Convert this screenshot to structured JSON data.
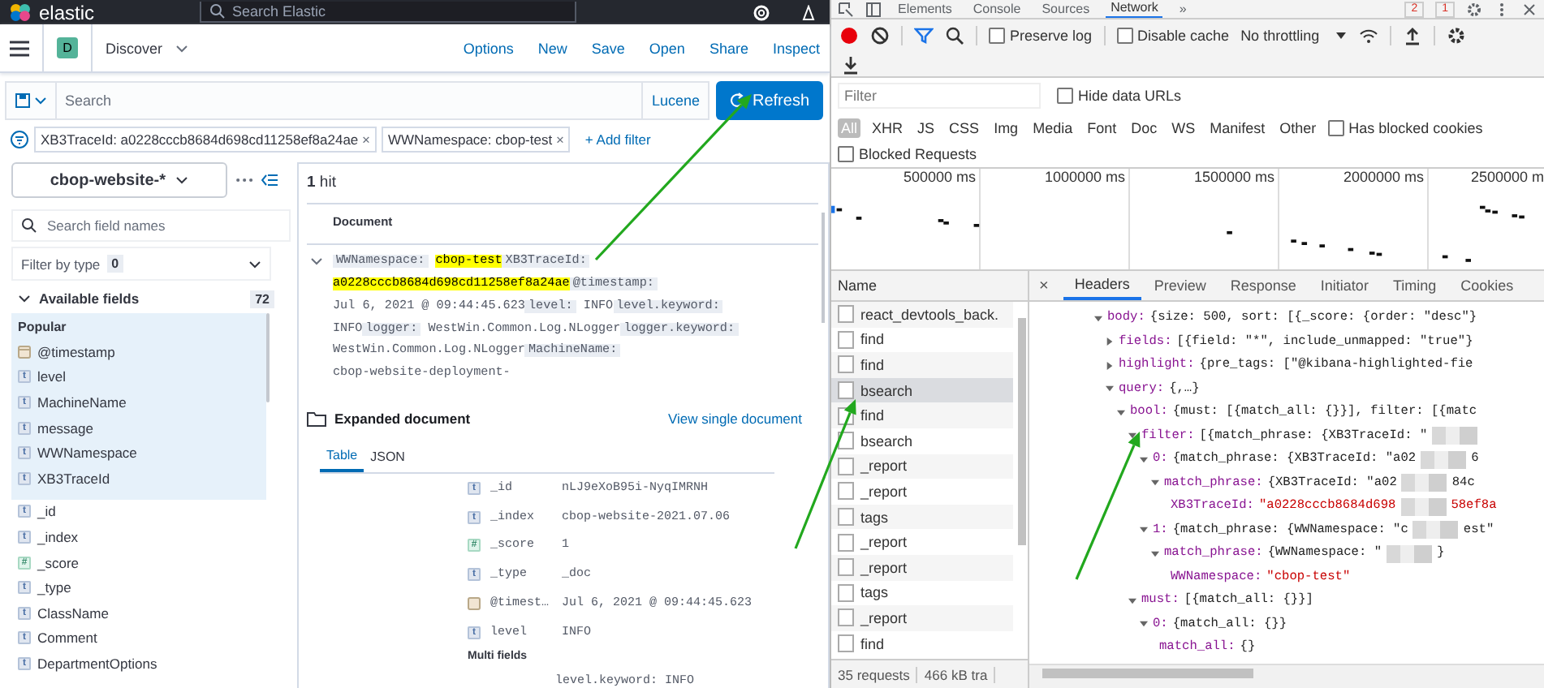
{
  "kibana": {
    "header": {
      "logo_text": "elastic",
      "search_placeholder": "Search Elastic"
    },
    "nav": {
      "app_badge": "D",
      "app_name": "Discover",
      "links": [
        "Options",
        "New",
        "Save",
        "Open",
        "Share",
        "Inspect"
      ]
    },
    "query_bar": {
      "placeholder": "Search",
      "language": "Lucene",
      "refresh": "Refresh"
    },
    "filters": [
      {
        "label": "XB3TraceId: a0228cccb8684d698cd11258ef8a24ae",
        "remove": "×"
      },
      {
        "label": "WWNamespace: cbop-test",
        "remove": "×"
      }
    ],
    "add_filter": "+ Add filter",
    "sidebar": {
      "index_pattern": "cbop-website-*",
      "search_placeholder": "Search field names",
      "filter_by_type": {
        "label": "Filter by type",
        "count": "0"
      },
      "available": {
        "label": "Available fields",
        "count": "72"
      },
      "popular_label": "Popular",
      "popular": [
        {
          "kind": "date",
          "name": "@timestamp"
        },
        {
          "kind": "string",
          "token": "t",
          "name": "level"
        },
        {
          "kind": "string",
          "token": "t",
          "name": "MachineName"
        },
        {
          "kind": "string",
          "token": "t",
          "name": "message"
        },
        {
          "kind": "string",
          "token": "t",
          "name": "WWNamespace"
        },
        {
          "kind": "string",
          "token": "t",
          "name": "XB3TraceId"
        }
      ],
      "fields": [
        {
          "kind": "string",
          "token": "t",
          "name": "_id"
        },
        {
          "kind": "string",
          "token": "t",
          "name": "_index"
        },
        {
          "kind": "number",
          "token": "#",
          "name": "_score"
        },
        {
          "kind": "string",
          "token": "t",
          "name": "_type"
        },
        {
          "kind": "string",
          "token": "t",
          "name": "ClassName"
        },
        {
          "kind": "string",
          "token": "t",
          "name": "Comment"
        },
        {
          "kind": "string",
          "token": "t",
          "name": "DepartmentOptions"
        }
      ]
    },
    "results": {
      "hits": "**1** hit",
      "document_header": "Document",
      "summary": [
        {
          "key": "WWNamespace:",
          "value": "cbop-test",
          "highlighted": true
        },
        {
          "key": "XB3TraceId:",
          "value": "a0228cccb8684d698cd11258ef8a24ae",
          "highlighted": true
        },
        {
          "key": "@timestamp:",
          "value": "Jul 6, 2021 @ 09:44:45.623",
          "highlighted": false
        },
        {
          "key": "level:",
          "value": "INFO",
          "highlighted": false
        },
        {
          "key": "level.keyword:",
          "value": "INFO",
          "highlighted": false
        },
        {
          "key": "logger:",
          "value": "WestWin.Common.Log.NLogger",
          "highlighted": false
        },
        {
          "key": "logger.keyword:",
          "value": "WestWin.Common.Log.NLogger",
          "highlighted": false
        },
        {
          "key": "MachineName:",
          "value": "cbop-website-deployment-",
          "highlighted": false
        }
      ],
      "expanded_title": "Expanded document",
      "view_single": "View single document",
      "tabs": [
        {
          "label": "Table",
          "selected": true
        },
        {
          "label": "JSON",
          "selected": false
        }
      ],
      "rows": [
        {
          "kind": "string",
          "token": "t",
          "field": "_id",
          "value": "nLJ9eXoB95i-NyqIMRNH"
        },
        {
          "kind": "string",
          "token": "t",
          "field": "_index",
          "value": "cbop-website-2021.07.06"
        },
        {
          "kind": "number",
          "token": "#",
          "field": "_score",
          "value": "1"
        },
        {
          "kind": "string",
          "token": "t",
          "field": "_type",
          "value": "_doc"
        },
        {
          "kind": "date",
          "field": "@timest…",
          "value": "Jul 6, 2021 @ 09:44:45.623"
        },
        {
          "kind": "string",
          "token": "t",
          "field": "level",
          "value": "INFO"
        }
      ],
      "multi_fields_label": "Multi fields",
      "multi_fields": [
        "level.keyword: INFO"
      ]
    }
  },
  "devtools": {
    "tabs": [
      {
        "label": "Elements",
        "selected": false
      },
      {
        "label": "Console",
        "selected": false
      },
      {
        "label": "Sources",
        "selected": false
      },
      {
        "label": "Network",
        "selected": true
      }
    ],
    "more_tabs": "»",
    "error_count": "2",
    "warning_count": "1",
    "toolbar": {
      "preserve_log": {
        "label": "Preserve log",
        "checked": false
      },
      "disable_cache": {
        "label": "Disable cache",
        "checked": false
      },
      "throttling": "No throttling"
    },
    "filter": {
      "placeholder": "Filter"
    },
    "hide_data_urls": {
      "label": "Hide data URLs",
      "checked": false
    },
    "types": [
      {
        "label": "All",
        "selected": true
      },
      {
        "label": "XHR",
        "selected": false
      },
      {
        "label": "JS",
        "selected": false
      },
      {
        "label": "CSS",
        "selected": false
      },
      {
        "label": "Img",
        "selected": false
      },
      {
        "label": "Media",
        "selected": false
      },
      {
        "label": "Font",
        "selected": false
      },
      {
        "label": "Doc",
        "selected": false
      },
      {
        "label": "WS",
        "selected": false
      },
      {
        "label": "Manifest",
        "selected": false
      },
      {
        "label": "Other",
        "selected": false
      }
    ],
    "has_blocked_cookies": {
      "label": "Has blocked cookies",
      "checked": false
    },
    "blocked_requests": {
      "label": "Blocked Requests",
      "checked": false
    },
    "timeline": {
      "ticks": [
        "500000 ms",
        "1000000 ms",
        "1500000 ms",
        "2000000 ms",
        "2500000 m"
      ]
    },
    "requests": {
      "header": "Name",
      "rows": [
        {
          "name": "react_devtools_back.",
          "selected": false
        },
        {
          "name": "find",
          "selected": false
        },
        {
          "name": "find",
          "selected": false
        },
        {
          "name": "bsearch",
          "selected": true
        },
        {
          "name": "find",
          "selected": false
        },
        {
          "name": "bsearch",
          "selected": false
        },
        {
          "name": "_report",
          "selected": false
        },
        {
          "name": "_report",
          "selected": false
        },
        {
          "name": "tags",
          "selected": false
        },
        {
          "name": "_report",
          "selected": false
        },
        {
          "name": "_report",
          "selected": false
        },
        {
          "name": "tags",
          "selected": false
        },
        {
          "name": "_report",
          "selected": false
        },
        {
          "name": "find",
          "selected": false
        }
      ]
    },
    "status": [
      "35 requests",
      "466 kB tra"
    ],
    "detail": {
      "close": "×",
      "tabs": [
        {
          "label": "Headers",
          "selected": true
        },
        {
          "label": "Preview",
          "selected": false
        },
        {
          "label": "Response",
          "selected": false
        },
        {
          "label": "Initiator",
          "selected": false
        },
        {
          "label": "Timing",
          "selected": false
        },
        {
          "label": "Cookies",
          "selected": false
        }
      ],
      "tree": [
        {
          "kind": "branch",
          "expanded": true,
          "key": "body:",
          "value": "{size: 500, sort: [{_score: {order: \"desc\"}",
          "children": [
            {
              "kind": "branch",
              "expanded": false,
              "key": "fields:",
              "value": "[{field: \"*\", include_unmapped: \"true\"}"
            },
            {
              "kind": "branch",
              "expanded": false,
              "key": "highlight:",
              "value": "{pre_tags: [\"@kibana-highlighted-fie"
            },
            {
              "kind": "branch",
              "expanded": true,
              "key": "query:",
              "value": "{,…}",
              "children": [
                {
                  "kind": "branch",
                  "expanded": true,
                  "key": "bool:",
                  "value": "{must: [{match_all: {}}], filter: [{matc",
                  "children": [
                    {
                      "kind": "branch",
                      "expanded": true,
                      "key": "filter:",
                      "value": "[{match_phrase: {XB3TraceId: \"",
                      "redacted": true,
                      "children": [
                        {
                          "kind": "branch",
                          "expanded": true,
                          "key": "0:",
                          "value": "{match_phrase: {XB3TraceId: \"a02",
                          "redacted": true,
                          "tail": "6",
                          "children": [
                            {
                              "kind": "branch",
                              "expanded": true,
                              "key": "match_phrase:",
                              "value": "{XB3TraceId: \"a02",
                              "redacted": true,
                              "tail": "84c",
                              "children": [
                                {
                                  "kind": "string",
                                  "key": "XB3TraceId:",
                                  "value": "\"a0228cccb8684d698",
                                  "redacted": true,
                                  "tail": "58ef8a"
                                }
                              ]
                            }
                          ]
                        },
                        {
                          "kind": "branch",
                          "expanded": true,
                          "key": "1:",
                          "value": "{match_phrase: {WWNamespace: \"c",
                          "redacted": true,
                          "tail": "est\"",
                          "children": [
                            {
                              "kind": "branch",
                              "expanded": true,
                              "key": "match_phrase:",
                              "value": "{WWNamespace: \"",
                              "redacted": true,
                              "tail": "}",
                              "children": [
                                {
                                  "kind": "string",
                                  "key": "WWNamespace:",
                                  "value": "\"cbop-test\""
                                }
                              ]
                            }
                          ]
                        }
                      ]
                    },
                    {
                      "kind": "branch",
                      "expanded": true,
                      "key": "must:",
                      "value": "[{match_all: {}}]",
                      "children": [
                        {
                          "kind": "branch",
                          "expanded": true,
                          "key": "0:",
                          "value": "{match_all: {}}",
                          "children": [
                            {
                              "kind": "plain",
                              "key": "match_all:",
                              "value": "{}"
                            }
                          ]
                        }
                      ]
                    }
                  ]
                }
              ]
            }
          ]
        }
      ]
    }
  }
}
